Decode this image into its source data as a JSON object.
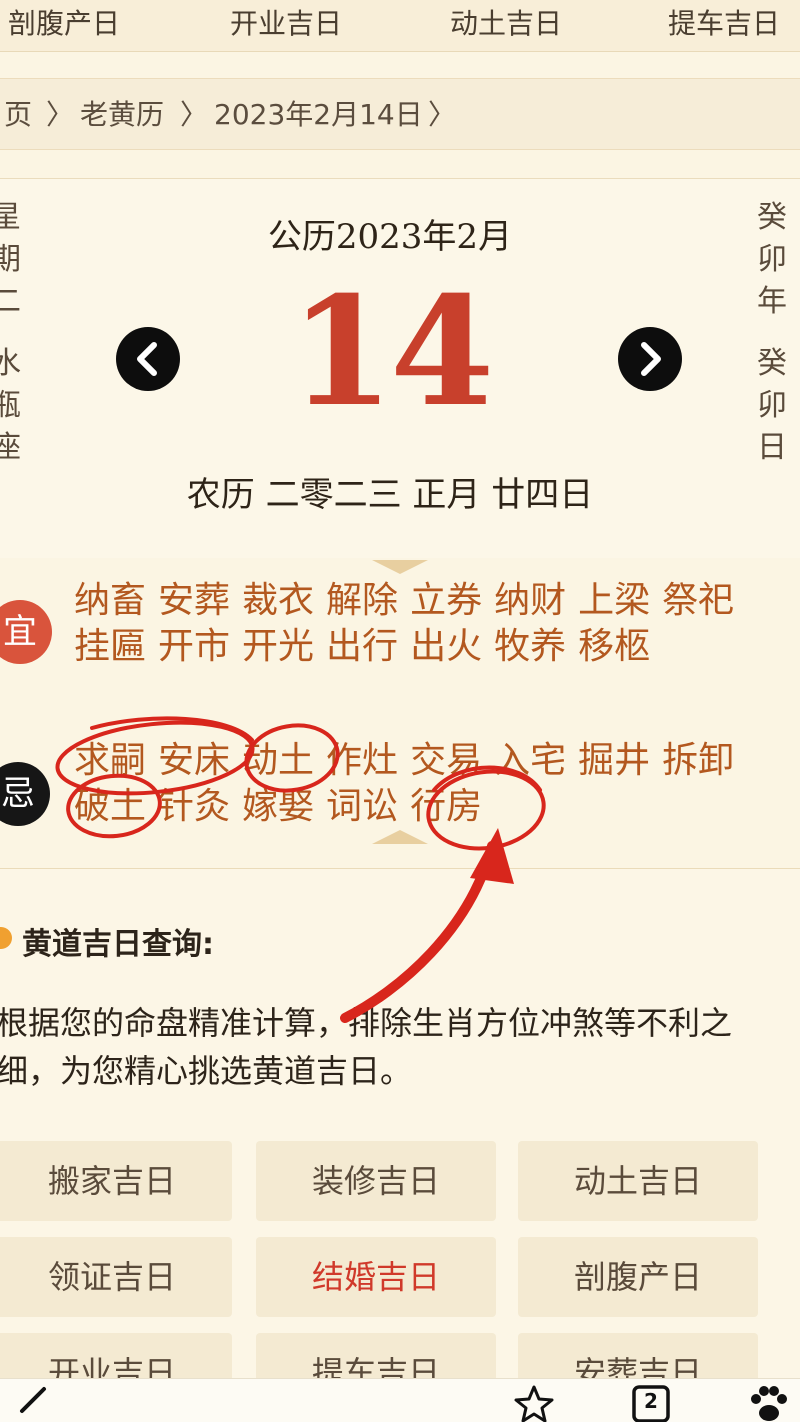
{
  "top_tabs": [
    "剖腹产日",
    "开业吉日",
    "动土吉日",
    "提车吉日"
  ],
  "breadcrumb": {
    "home": "页",
    "sep1": "〉",
    "section": "老黄历",
    "sep2": "〉",
    "date": "2023年2月14日",
    "sep3": "〉"
  },
  "calendar": {
    "solar_title": "公历2023年2月",
    "day": "14",
    "lunar": "农历 二零二三 正月 廿四日",
    "left_side": [
      "星",
      "期",
      "二",
      "",
      "水",
      "瓶",
      "座"
    ],
    "right_side": [
      "癸",
      "卯",
      "年",
      "",
      "癸",
      "卯",
      "日"
    ]
  },
  "yi": {
    "badge": "宜",
    "row1": [
      "纳畜",
      "安葬",
      "裁衣",
      "解除",
      "立券",
      "纳财",
      "上梁",
      "祭祀"
    ],
    "row2": [
      "挂匾",
      "开市",
      "开光",
      "出行",
      "出火",
      "牧养",
      "移柩"
    ]
  },
  "ji": {
    "badge": "忌",
    "row1": [
      "求嗣",
      "安床",
      "动土",
      "作灶",
      "交易",
      "入宅",
      "掘井",
      "拆卸"
    ],
    "row2": [
      "破土",
      "针灸",
      "嫁娶",
      "词讼",
      "行房"
    ]
  },
  "query": {
    "title": "黄道吉日查询:",
    "desc_line1": "根据您的命盘精准计算，排除生肖方位冲煞等不利之",
    "desc_line2": "细，为您精心挑选黄道吉日。",
    "buttons": [
      "搬家吉日",
      "装修吉日",
      "动土吉日",
      "领证吉日",
      "结婚吉日",
      "剖腹产日",
      "开业吉日",
      "提车吉日",
      "安葬吉日"
    ],
    "active_button": "结婚吉日"
  },
  "bottom_bar": {
    "tab_count": "2"
  },
  "colors": {
    "day_red": "#c8402c",
    "yi_text": "#b3581f",
    "yi_badge": "#d9543c",
    "ji_badge": "#161616",
    "annotation_red": "#d8261c"
  }
}
